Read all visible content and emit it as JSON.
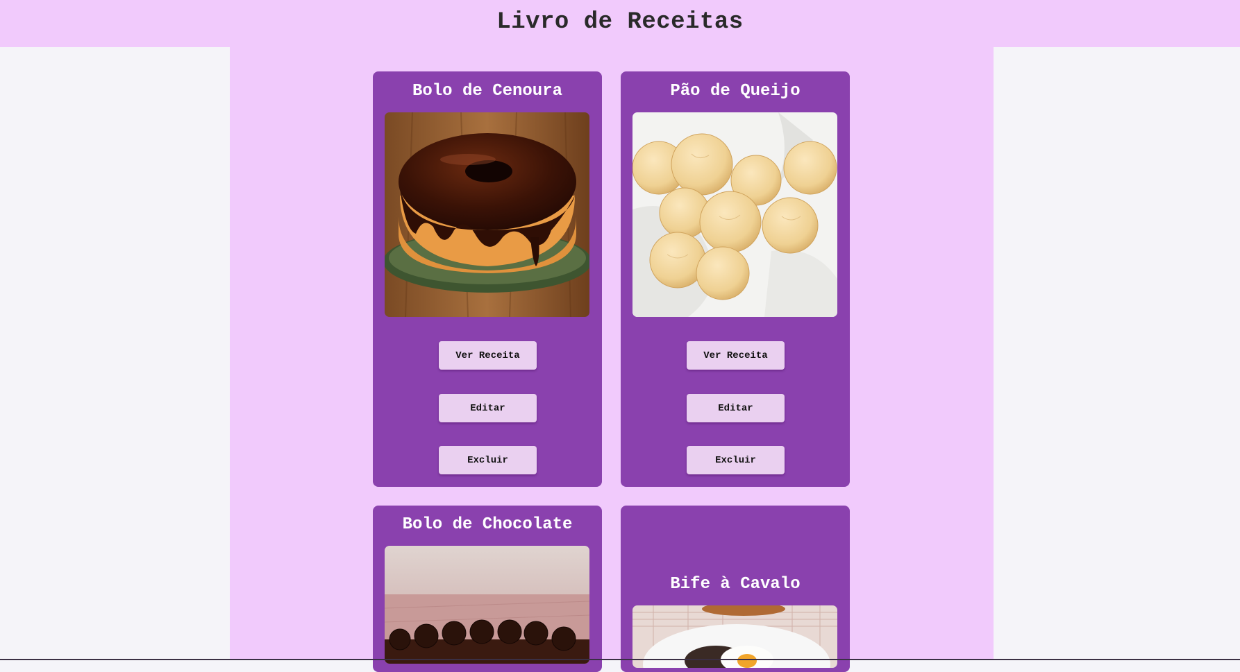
{
  "header": {
    "title": "Livro de Receitas"
  },
  "colors": {
    "header_bg": "#f1cafc",
    "page_bg": "#f5f4f9",
    "card_bg": "#8a41ae",
    "button_bg": "#ead0f0",
    "title_text": "#2a2a2a",
    "card_title_text": "#ffffff"
  },
  "recipes": [
    {
      "title": "Bolo de Cenoura",
      "image": "carrot-cake-with-chocolate-glaze",
      "buttons": {
        "view": "Ver Receita",
        "edit": "Editar",
        "delete": "Excluir"
      }
    },
    {
      "title": "Pão de Queijo",
      "image": "cheese-bread-rolls-in-napkin",
      "buttons": {
        "view": "Ver Receita",
        "edit": "Editar",
        "delete": "Excluir"
      }
    },
    {
      "title": "Bolo de Chocolate",
      "image": "chocolate-cake-with-brigadeiros"
    },
    {
      "title": "Bife à Cavalo",
      "image": "steak-with-fried-egg"
    }
  ]
}
